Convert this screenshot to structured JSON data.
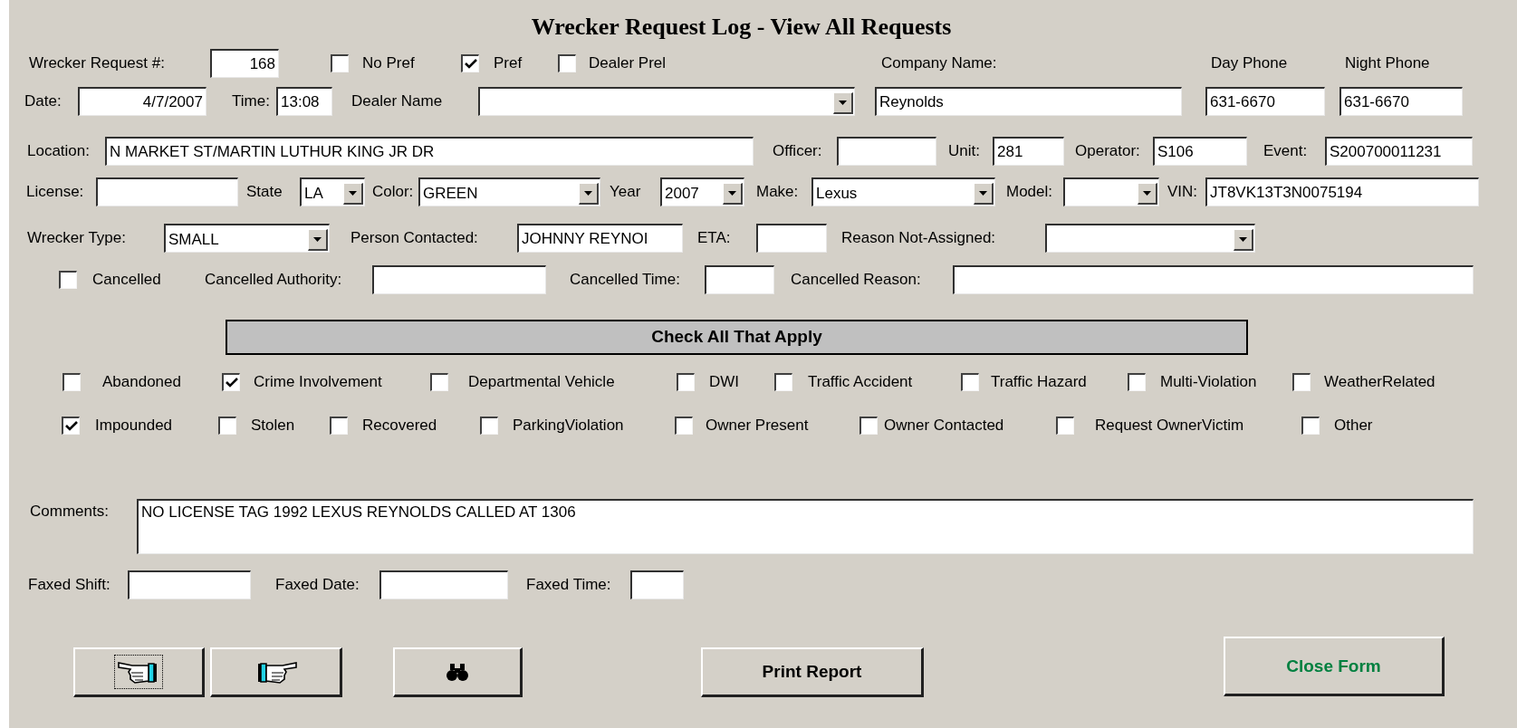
{
  "title": "Wrecker Request Log - View All Requests",
  "rows": [
    {
      "items": [
        {
          "kind": "field",
          "label": "Wrecker Request #:",
          "value": "168"
        },
        {
          "kind": "checkbox",
          "label": "No Pref",
          "checked": false
        },
        {
          "kind": "checkbox",
          "label": "Pref",
          "checked": true
        },
        {
          "kind": "checkbox",
          "label": "Dealer Prel",
          "checked": false
        },
        {
          "kind": "caption",
          "label": "Company Name:"
        },
        {
          "kind": "caption",
          "label": "Day Phone"
        },
        {
          "kind": "caption",
          "label": "Night Phone"
        }
      ]
    },
    {
      "items": [
        {
          "kind": "field",
          "label": "Date:",
          "value": "4/7/2007"
        },
        {
          "kind": "field",
          "label": "Time:",
          "value": "13:08"
        },
        {
          "kind": "dropdown",
          "label": "Dealer Name"
        },
        {
          "kind": "field",
          "value": "Reynolds"
        },
        {
          "kind": "field",
          "value": "631-6670"
        },
        {
          "kind": "field",
          "value": "631-6670"
        }
      ]
    },
    {
      "items": [
        {
          "kind": "field",
          "label": "Location:",
          "value": "N MARKET ST/MARTIN LUTHUR KING JR DR"
        },
        {
          "kind": "field",
          "label": "Officer:"
        },
        {
          "kind": "field",
          "label": "Unit:",
          "value": "281"
        },
        {
          "kind": "field",
          "label": "Operator:",
          "value": "S106"
        },
        {
          "kind": "field",
          "label": "Event:",
          "value": "S200700011231"
        }
      ]
    },
    {
      "items": [
        {
          "kind": "field",
          "label": "License:"
        },
        {
          "kind": "dropdown",
          "label": "State",
          "value": "LA"
        },
        {
          "kind": "dropdown",
          "label": "Color:",
          "value": "GREEN"
        },
        {
          "kind": "dropdown",
          "label": "Year",
          "value": "2007"
        },
        {
          "kind": "dropdown",
          "label": "Make:",
          "value": "Lexus"
        },
        {
          "kind": "dropdown",
          "label": "Model:"
        },
        {
          "kind": "field",
          "label": "VIN:",
          "value": "JT8VK13T3N0075194"
        }
      ]
    },
    {
      "items": [
        {
          "kind": "dropdown",
          "label": "Wrecker Type:",
          "value": "SMALL"
        },
        {
          "kind": "field",
          "label": "Person Contacted:",
          "value": "JOHNNY REYNOI"
        },
        {
          "kind": "field",
          "label": "ETA:"
        },
        {
          "kind": "dropdown",
          "label": "Reason Not-Assigned:"
        }
      ]
    },
    {
      "items": [
        {
          "kind": "checkbox",
          "label": "Cancelled",
          "checked": false
        },
        {
          "kind": "field",
          "label": "Cancelled Authority:"
        },
        {
          "kind": "field",
          "label": "Cancelled Time:"
        },
        {
          "kind": "field",
          "label": "Cancelled Reason:"
        }
      ]
    }
  ],
  "section_title": "Check All That Apply",
  "flags": [
    {
      "items": [
        {
          "kind": "checkbox",
          "label": "Abandoned",
          "checked": false
        },
        {
          "kind": "checkbox",
          "label": "Crime Involvement",
          "checked": true
        },
        {
          "kind": "checkbox",
          "label": "Departmental Vehicle",
          "checked": false
        },
        {
          "kind": "checkbox",
          "label": "DWI",
          "checked": false
        },
        {
          "kind": "checkbox",
          "label": "Traffic Accident",
          "checked": false
        },
        {
          "kind": "checkbox",
          "label": "Traffic Hazard",
          "checked": false
        },
        {
          "kind": "checkbox",
          "label": "Multi-Violation",
          "checked": false
        },
        {
          "kind": "checkbox",
          "label": "WeatherRelated",
          "checked": false
        }
      ]
    },
    {
      "items": [
        {
          "kind": "checkbox",
          "label": "Impounded",
          "checked": true
        },
        {
          "kind": "checkbox",
          "label": "Stolen",
          "checked": false
        },
        {
          "kind": "checkbox",
          "label": "Recovered",
          "checked": false
        },
        {
          "kind": "checkbox",
          "label": "ParkingViolation",
          "checked": false
        },
        {
          "kind": "checkbox",
          "label": "Owner Present",
          "checked": false
        },
        {
          "kind": "checkbox",
          "label": "Owner Contacted",
          "checked": false
        },
        {
          "kind": "checkbox",
          "label": "Request OwnerVictim",
          "checked": false
        },
        {
          "kind": "checkbox",
          "label": "Other",
          "checked": false
        }
      ]
    }
  ],
  "comments": {
    "label": "Comments:",
    "value": "NO LICENSE TAG 1992 LEXUS REYNOLDS CALLED AT 1306"
  },
  "fax_row": {
    "items": [
      {
        "kind": "field",
        "label": "Faxed Shift:"
      },
      {
        "kind": "field",
        "label": "Faxed Date:"
      },
      {
        "kind": "field",
        "label": "Faxed Time:"
      }
    ]
  },
  "buttons": [
    {
      "kind": "previous",
      "focused": true
    },
    {
      "kind": "next",
      "focused": false
    },
    {
      "kind": "find",
      "focused": false
    },
    {
      "kind": "text",
      "label": "Print Report",
      "focused": false
    },
    {
      "kind": "text",
      "label": "Close Form",
      "color": "#008040",
      "focused": false
    }
  ]
}
